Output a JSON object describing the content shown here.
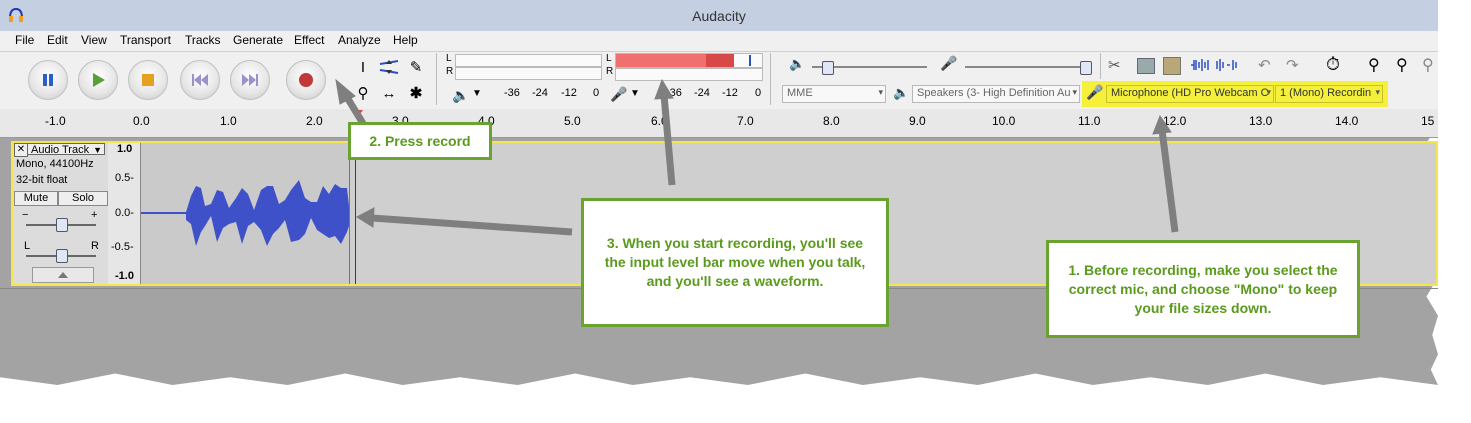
{
  "window": {
    "title": "Audacity"
  },
  "menu": [
    "File",
    "Edit",
    "View",
    "Transport",
    "Tracks",
    "Generate",
    "Effect",
    "Analyze",
    "Help"
  ],
  "meters": {
    "play_l": "L",
    "play_r": "R",
    "rec_l": "L",
    "rec_r": "R",
    "scale": [
      "-36",
      "-24",
      "-12",
      "0"
    ],
    "rec_scale": [
      "-36",
      "-24",
      "-12",
      "0"
    ]
  },
  "device": {
    "host": "MME",
    "output": "Speakers (3- High Definition Au",
    "input": "Microphone (HD Pro Webcam C",
    "channels": "1 (Mono) Recordin"
  },
  "ruler": {
    "labels": [
      "-1.0",
      "0.0",
      "1.0",
      "2.0",
      "3.0",
      "4.0",
      "5.0",
      "6.0",
      "7.0",
      "8.0",
      "9.0",
      "10.0",
      "11.0",
      "12.0",
      "13.0",
      "14.0",
      "15"
    ]
  },
  "track": {
    "name": "Audio Track",
    "rate": "Mono, 44100Hz",
    "format": "32-bit float",
    "mute": "Mute",
    "solo": "Solo",
    "gain_min": "−",
    "gain_max": "+",
    "pan_l": "L",
    "pan_r": "R",
    "scale": [
      "1.0",
      "0.5-",
      "0.0-",
      "-0.5-",
      "-1.0"
    ]
  },
  "callouts": {
    "c1": "1. Before recording, make you select the correct mic, and choose \"Mono\" to keep your file sizes down.",
    "c2": "2. Press record",
    "c3": "3. When you start recording, you'll see the input level bar move when you talk, and you'll see a waveform."
  },
  "colors": {
    "accent_green": "#6aa32f",
    "highlight": "#f5f03a",
    "meter_red": "#f07070",
    "waveform": "#3f51c9",
    "cursor": "#cc0000"
  }
}
